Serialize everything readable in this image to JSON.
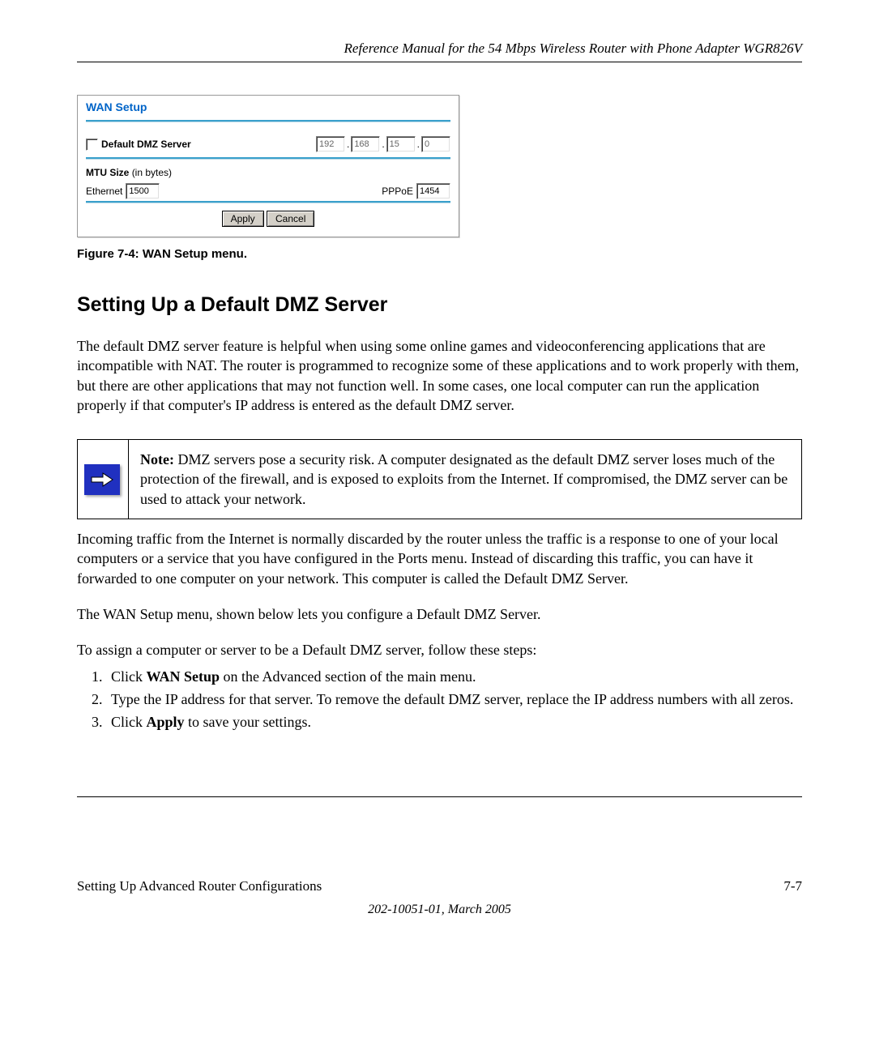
{
  "header": {
    "title": "Reference Manual for the 54 Mbps Wireless Router with Phone Adapter WGR826V"
  },
  "screenshot": {
    "panel_title": "WAN Setup",
    "dmz_label": "Default DMZ Server",
    "ip": {
      "a": "192",
      "b": "168",
      "c": "15",
      "d": "0"
    },
    "mtu_label": "MTU Size",
    "mtu_units": "(in bytes)",
    "ethernet_label": "Ethernet",
    "ethernet_value": "1500",
    "pppoe_label": "PPPoE",
    "pppoe_value": "1454",
    "apply_label": "Apply",
    "cancel_label": "Cancel"
  },
  "figure_caption": "Figure 7-4:  WAN Setup menu.",
  "section_heading": "Setting Up a Default DMZ Server",
  "para1": "The default DMZ server feature is helpful when using some online games and videoconferencing applications that are incompatible with NAT. The router is programmed to recognize some of these applications and to work properly with them, but there are other applications that may not function well. In some cases, one local computer can run the application properly if that computer's IP address is entered as the default DMZ server.",
  "note": {
    "label": "Note:",
    "text": " DMZ servers pose a security risk. A computer designated as the default DMZ server loses much of the protection of the firewall, and is exposed to exploits from the Internet. If compromised, the DMZ server can be used to attack your network."
  },
  "para2": "Incoming traffic from the Internet is normally discarded by the router unless the traffic is a response to one of your local computers or a service that you have configured in the Ports menu. Instead of discarding this traffic, you can have it forwarded to one computer on your network. This computer is called the Default DMZ Server.",
  "para3": "The WAN Setup menu, shown below lets you configure a Default DMZ Server.",
  "para4": "To assign a computer or server to be a Default DMZ server, follow these steps:",
  "steps": {
    "s1a": "Click ",
    "s1b": "WAN Setup",
    "s1c": " on the Advanced section of the main menu.",
    "s2": "Type the IP address for that server. To remove the default DMZ server, replace the IP address numbers with all zeros.",
    "s3a": "Click ",
    "s3b": "Apply",
    "s3c": " to save your settings."
  },
  "footer": {
    "left": "Setting Up Advanced Router Configurations",
    "right": "7-7",
    "docnum": "202-10051-01, March 2005"
  }
}
